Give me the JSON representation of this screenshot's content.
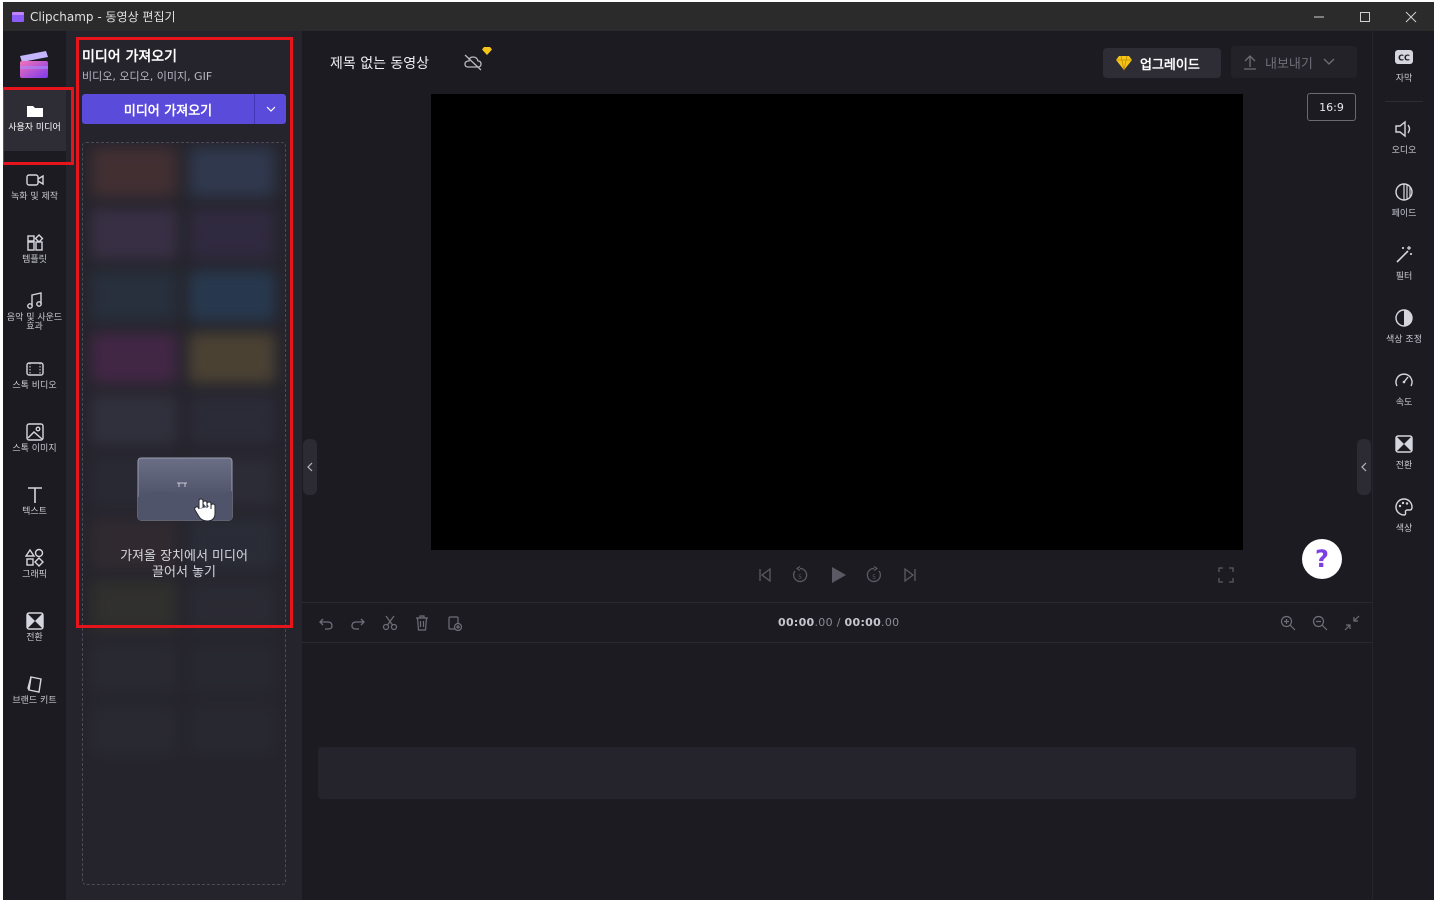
{
  "window": {
    "title": "Clipchamp - 동영상 편집기",
    "controls": [
      "minimize",
      "maximize",
      "close"
    ]
  },
  "left_rail": {
    "items": [
      {
        "label": "사용자 미디어",
        "icon": "folder-icon",
        "active": true
      },
      {
        "label": "녹화 및 제작",
        "icon": "camera-icon"
      },
      {
        "label": "템플릿",
        "icon": "template-icon"
      },
      {
        "label": "음악 및 사운드 효과",
        "icon": "music-icon"
      },
      {
        "label": "스톡 비디오",
        "icon": "film-icon"
      },
      {
        "label": "스톡 이미지",
        "icon": "image-icon"
      },
      {
        "label": "텍스트",
        "icon": "text-icon"
      },
      {
        "label": "그래픽",
        "icon": "shapes-icon"
      },
      {
        "label": "전환",
        "icon": "transition-icon"
      },
      {
        "label": "브랜드 키트",
        "icon": "brand-kit-icon"
      }
    ]
  },
  "media_panel": {
    "title": "미디어 가져오기",
    "subtitle": "비디오, 오디오, 이미지, GIF",
    "import_button": "미디어 가져오기",
    "drop_text_line1": "가져올 장치에서 미디어",
    "drop_text_line2": "끌어서 놓기"
  },
  "header": {
    "project_title": "제목 없는 동영상",
    "upgrade_label": "업그레이드",
    "export_label": "내보내기",
    "aspect_ratio": "16:9"
  },
  "timeline": {
    "current_time_main": "00:00",
    "current_time_frac": ".00",
    "separator": " / ",
    "total_time_main": "00:00",
    "total_time_frac": ".00"
  },
  "right_rail": {
    "items": [
      {
        "label": "자막",
        "icon": "captions-icon"
      },
      {
        "label": "오디오",
        "icon": "speaker-icon"
      },
      {
        "label": "페이드",
        "icon": "fade-icon"
      },
      {
        "label": "필터",
        "icon": "magic-wand-icon"
      },
      {
        "label": "색상 조정",
        "icon": "contrast-icon"
      },
      {
        "label": "속도",
        "icon": "speedometer-icon"
      },
      {
        "label": "전환",
        "icon": "transition-icon"
      },
      {
        "label": "색상",
        "icon": "palette-icon"
      }
    ]
  },
  "colors": {
    "accent": "#5b4bdb",
    "highlight": "#e8141b",
    "background": "#1c1b22",
    "panel": "#25242c"
  }
}
